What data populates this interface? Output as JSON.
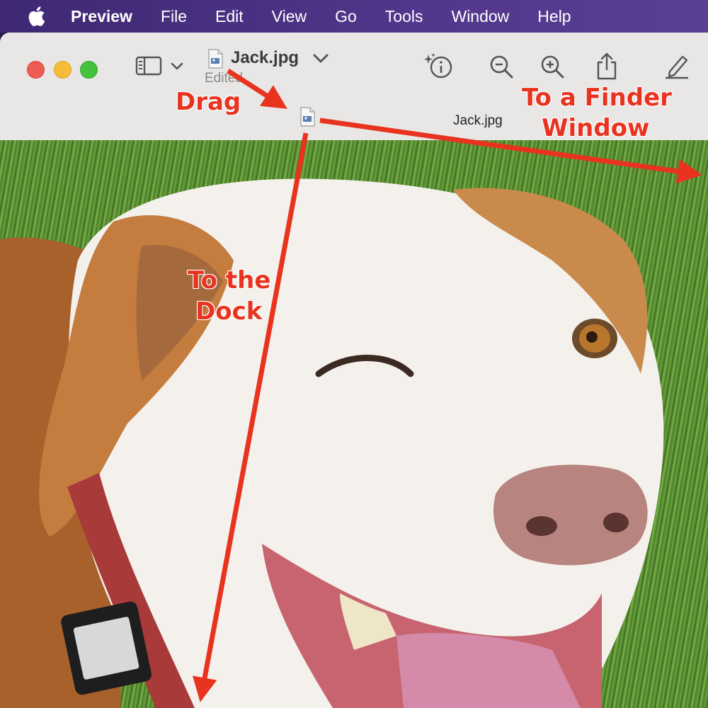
{
  "menubar": {
    "app_name": "Preview",
    "items": [
      "File",
      "Edit",
      "View",
      "Go",
      "Tools",
      "Window",
      "Help"
    ]
  },
  "window": {
    "document_title": "Jack.jpg",
    "document_status": "Edited",
    "drag_proxy_title": "Jack.jpg"
  },
  "annotations": {
    "drag": "Drag",
    "to_finder_line1": "To a Finder",
    "to_finder_line2": "Window",
    "to_dock_line1": "To the",
    "to_dock_line2": "Dock"
  },
  "toolbar_icons": [
    "sidebar-icon",
    "chevron-down-icon",
    "info-icon",
    "zoom-out-icon",
    "zoom-in-icon",
    "share-icon",
    "markup-pen-icon"
  ],
  "colors": {
    "annotation_red": "#e8331f",
    "menubar_purple": "#4a3280"
  }
}
